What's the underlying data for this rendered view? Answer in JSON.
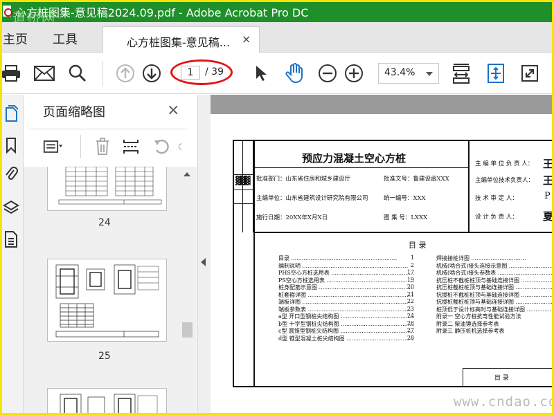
{
  "window": {
    "title": "心方桩图集-意见稿2024.09.pdf - Adobe Acrobat Pro DC",
    "watermark": "道桥网"
  },
  "nav": {
    "home": "主页",
    "tools": "工具"
  },
  "doc_tab": {
    "label": "心方桩图集-意见稿...",
    "close": "×"
  },
  "toolbar": {
    "page_current": "1",
    "page_total": "/ 39",
    "zoom": "43.4%"
  },
  "panel": {
    "title": "页面缩略图",
    "close": "×",
    "thumbnails": [
      {
        "page": "24"
      },
      {
        "page": "25"
      }
    ]
  },
  "drawing": {
    "title": "预应力混凝土空心方桩",
    "approval_dept": "批准部门：山东省住房和城乡建设厅",
    "approval_doc": "批准文号：鲁建设函XXX",
    "chief_unit": "主编单位：山东省建筑设计研究院有限公司",
    "unified_no": "统一编号：XXX",
    "impl_date": "施行日期：20XX年X月X日",
    "atlas_no": "图  集  号：LXXX",
    "roles": [
      "主 编 单 位 负 责 人：",
      "主编单位技术负责人：",
      "技 术 审 定 人：",
      "设 计 负 责 人："
    ],
    "toc_title": "目   录",
    "toc_left": [
      {
        "text": "目录",
        "page": "1"
      },
      {
        "text": "编制说明",
        "page": "2"
      },
      {
        "text": "PHS空心方桩选用表",
        "page": "17"
      },
      {
        "text": "PS空心方桩选用表",
        "page": "19"
      },
      {
        "text": "桩身配筋示意图",
        "page": "20"
      },
      {
        "text": "桩套箍详图",
        "page": "21"
      },
      {
        "text": "端板详图",
        "page": "22"
      },
      {
        "text": "端板参数表",
        "page": "23"
      },
      {
        "text": "a型 开口型钢桩尖结构图",
        "page": "24"
      },
      {
        "text": "b型 十字型钢桩尖结构图",
        "page": "26"
      },
      {
        "text": "c型 圆锥型钢桩尖结构图",
        "page": "27"
      },
      {
        "text": "d型 锥型混凝土桩尖结构图",
        "page": "28"
      }
    ],
    "toc_right": [
      "焊接接桩详图",
      "机械(啮合式)接头连接示意图",
      "机械(啮合式)接头参数表",
      "抗压桩不截桩桩顶与基础连接详图",
      "抗压桩截桩桩顶与基础连接详图",
      "抗拔桩不截桩桩顶与基础连接详图",
      "抗拔桩截桩桩顶与基础连接详图",
      "桩顶低于设计标高时与基础连接详图",
      "附录一  空心方桩抗弯性能试验方法",
      "附录二  柴油锤选择参考表",
      "附录三  静压桩机选择参考表"
    ],
    "footer_label": "目      录"
  },
  "site_watermark": "www.cndao.com"
}
